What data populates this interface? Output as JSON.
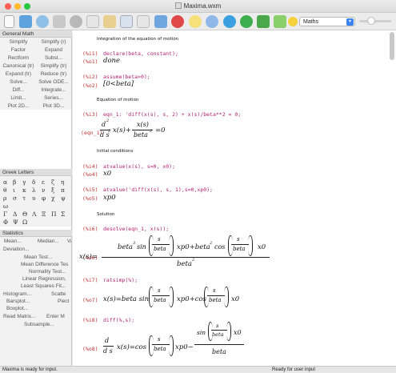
{
  "window": {
    "title": "Maxima.wxm"
  },
  "toolbar": {
    "buttons": [
      "new-document",
      "open",
      "save",
      "print",
      "settings",
      "cut",
      "copy",
      "paste",
      "find",
      "restart",
      "stop",
      "interrupt",
      "back",
      "forward",
      "follow",
      "export",
      "zoom-out",
      "help"
    ],
    "math_select": "Maths"
  },
  "sidebar": {
    "general_math": {
      "header": "General Math",
      "rows": [
        [
          "Simplify",
          "Simplify (r)"
        ],
        [
          "Factor",
          "Expand"
        ],
        [
          "Rectform",
          "Subst..."
        ],
        [
          "Canonical (tr)",
          "Simplify (tr)"
        ],
        [
          "Expand (tr)",
          "Reduce (tr)"
        ],
        [
          "Solve...",
          "Solve ODE..."
        ],
        [
          "Diff...",
          "Integrate..."
        ],
        [
          "Limit...",
          "Series..."
        ],
        [
          "Plot 2D...",
          "Plot 3D..."
        ]
      ]
    },
    "greek": {
      "header": "Greek Letters",
      "rows": [
        [
          "α",
          "β",
          "γ",
          "δ",
          "ε",
          "ζ",
          "η"
        ],
        [
          "θ",
          "ι",
          "κ",
          "λ",
          "ν",
          "ξ",
          "π"
        ],
        [
          "ρ",
          "σ",
          "τ",
          "υ",
          "φ",
          "χ",
          "ψ"
        ],
        [
          "ω"
        ],
        [
          "Γ",
          "Δ",
          "Θ",
          "Λ",
          "Ξ",
          "Π",
          "Σ"
        ],
        [
          "Φ",
          "Ψ",
          "Ω"
        ]
      ]
    },
    "statistics": {
      "header": "Statistics",
      "items": [
        "Mean...",
        "Median...",
        "Va",
        "Deviation...",
        "Mean Test...",
        "Mean Difference Tes",
        "Normality Test...",
        "Linear Regression,",
        "Least Squares Fit...",
        "Histogram...",
        "Scatte",
        "Barsplot...",
        "Piect",
        "Boxplot...",
        "Read Matrix...",
        "Enter M",
        "Subsample..."
      ]
    }
  },
  "doc": {
    "text1": "Integration of the equation of motion",
    "l_i1": "(%i1)",
    "c_i1": "declare(beta, constant);",
    "l_o1": "(%o1)",
    "o1": "done",
    "l_i2": "(%i2)",
    "c_i2": "assume(beta>0);",
    "l_o2": "(%o2)",
    "o2": "[0<beta]",
    "text2": "Equation of motion",
    "l_i3": "(%i3)",
    "c_i3": "eqn_1:  'diff(x(s), s, 2) + x(s)/beta**2 = 0;",
    "l_eqn1": "(eqn_1)",
    "text3": "Initial conditions",
    "l_i4": "(%i4)",
    "c_i4": "atvalue(x(s), s=0, x0);",
    "l_o4": "(%o4)",
    "o4": "x0",
    "l_i5": "(%i5)",
    "c_i5": "atvalue('diff(x(s), s, 1),s=0,xp0);",
    "l_o5": "(%o5)",
    "o5": "xp0",
    "text4": "Solution",
    "l_i6": "(%i6)",
    "c_i6": "desolve(eqn_1, x(s));",
    "l_o6": "(%o6)",
    "l_i7": "(%i7)",
    "c_i7": "ratsimp(%);",
    "l_o7": "(%o7)",
    "l_i8": "(%i8)",
    "c_i8": "diff(%,s);",
    "l_o8": "(%o8)"
  },
  "status": {
    "left": "Maxima is ready for input.",
    "right": "Ready for user input"
  },
  "colors": {
    "label": "#c03030",
    "input": "#b01e6e",
    "toolbar_bg": "#ececec",
    "sidebar_bg": "#f2f2f2"
  }
}
